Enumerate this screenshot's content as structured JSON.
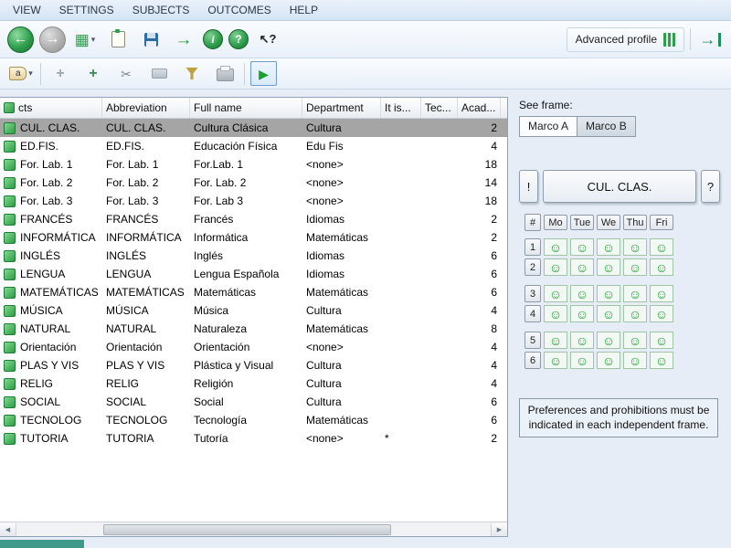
{
  "menu": {
    "items": [
      "VIEW",
      "SETTINGS",
      "SUBJECTS",
      "OUTCOMES",
      "HELP"
    ]
  },
  "toolbar": {
    "advanced_profile_label": "Advanced profile"
  },
  "icons": {
    "back": "←",
    "forward": "→",
    "views": "▦",
    "dropdown": "▾",
    "export": "→",
    "info": "i",
    "help": "?",
    "context_help": "↖?",
    "go": "→",
    "tag": "a",
    "add": "+",
    "cut": "✂",
    "run": "▶",
    "scroll_left": "◀",
    "scroll_right": "▶",
    "smiley": "☺"
  },
  "colors": {
    "accent_green": "#2f9e4f",
    "selected_row": "#a5a5a5",
    "window_background": "#e6edf7"
  },
  "table": {
    "columns": [
      "cts",
      "Abbreviation",
      "Full name",
      "Department",
      "It is...",
      "Tec...",
      "Acad..."
    ],
    "rows": [
      {
        "name": "CUL. CLAS.",
        "abbr": "CUL. CLAS.",
        "full": "Cultura Clásica",
        "dept": "Cultura",
        "it_is": "",
        "tec": "",
        "acad": "2",
        "selected": true
      },
      {
        "name": "ED.FIS.",
        "abbr": "ED.FIS.",
        "full": "Educación Física",
        "dept": "Edu Fis",
        "it_is": "",
        "tec": "",
        "acad": "4"
      },
      {
        "name": "For. Lab. 1",
        "abbr": "For. Lab. 1",
        "full": "For.Lab. 1",
        "dept": "<none>",
        "it_is": "",
        "tec": "",
        "acad": "18"
      },
      {
        "name": "For. Lab. 2",
        "abbr": "For. Lab. 2",
        "full": "For. Lab. 2",
        "dept": "<none>",
        "it_is": "",
        "tec": "",
        "acad": "14"
      },
      {
        "name": "For. Lab. 3",
        "abbr": "For. Lab. 3",
        "full": "For. Lab 3",
        "dept": "<none>",
        "it_is": "",
        "tec": "",
        "acad": "18"
      },
      {
        "name": "FRANCÉS",
        "abbr": "FRANCÉS",
        "full": "Francés",
        "dept": "Idiomas",
        "it_is": "",
        "tec": "",
        "acad": "2"
      },
      {
        "name": "INFORMÁTICA",
        "abbr": "INFORMÁTICA",
        "full": "Informática",
        "dept": "Matemáticas",
        "it_is": "",
        "tec": "",
        "acad": "2"
      },
      {
        "name": "INGLÉS",
        "abbr": "INGLÉS",
        "full": "Inglés",
        "dept": "Idiomas",
        "it_is": "",
        "tec": "",
        "acad": "6"
      },
      {
        "name": "LENGUA",
        "abbr": "LENGUA",
        "full": "Lengua Española",
        "dept": "Idiomas",
        "it_is": "",
        "tec": "",
        "acad": "6"
      },
      {
        "name": "MATEMÁTICAS",
        "abbr": "MATEMÁTICAS",
        "full": "Matemáticas",
        "dept": "Matemáticas",
        "it_is": "",
        "tec": "",
        "acad": "6"
      },
      {
        "name": "MÚSICA",
        "abbr": "MÚSICA",
        "full": "Música",
        "dept": "Cultura",
        "it_is": "",
        "tec": "",
        "acad": "4"
      },
      {
        "name": "NATURAL",
        "abbr": "NATURAL",
        "full": "Naturaleza",
        "dept": "Matemáticas",
        "it_is": "",
        "tec": "",
        "acad": "8"
      },
      {
        "name": "Orientación",
        "abbr": "Orientación",
        "full": "Orientación",
        "dept": "<none>",
        "it_is": "",
        "tec": "",
        "acad": "4"
      },
      {
        "name": "PLAS Y VIS",
        "abbr": "PLAS Y VIS",
        "full": "Plástica y Visual",
        "dept": "Cultura",
        "it_is": "",
        "tec": "",
        "acad": "4"
      },
      {
        "name": "RELIG",
        "abbr": "RELIG",
        "full": "Religión",
        "dept": "Cultura",
        "it_is": "",
        "tec": "",
        "acad": "4"
      },
      {
        "name": "SOCIAL",
        "abbr": "SOCIAL",
        "full": "Social",
        "dept": "Cultura",
        "it_is": "",
        "tec": "",
        "acad": "6"
      },
      {
        "name": "TECNOLOG",
        "abbr": "TECNOLOG",
        "full": "Tecnología",
        "dept": "Matemáticas",
        "it_is": "",
        "tec": "",
        "acad": "6"
      },
      {
        "name": "TUTORIA",
        "abbr": "TUTORIA",
        "full": "Tutoría",
        "dept": "<none>",
        "it_is": "*",
        "tec": "",
        "acad": "2"
      }
    ]
  },
  "frame_panel": {
    "see_frame_label": "See frame:",
    "tabs": [
      "Marco A",
      "Marco B"
    ],
    "warning_button": "!",
    "subject_button": "CUL. CLAS.",
    "help_button": "?",
    "grid": {
      "corner": "#",
      "days": [
        "Mo",
        "Tue",
        "We",
        "Thu",
        "Fri"
      ],
      "periods": [
        "1",
        "2",
        "3",
        "4",
        "5",
        "6"
      ]
    },
    "note": "Preferences and prohibitions must be indicated in each independent frame."
  }
}
